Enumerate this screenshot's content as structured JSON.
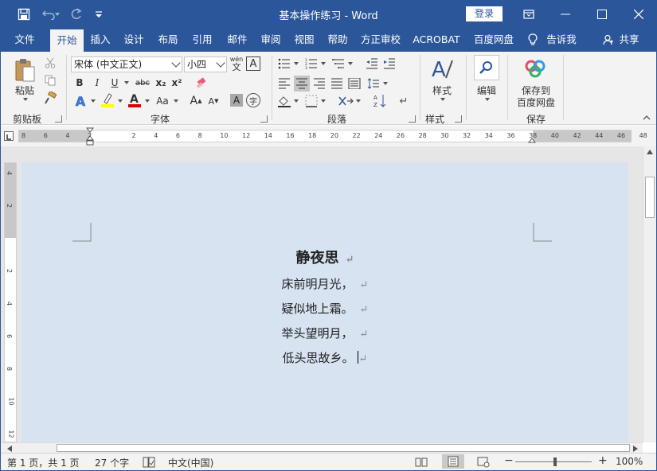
{
  "titlebar": {
    "title": "基本操作练习  -  Word",
    "login": "登录"
  },
  "tabs": [
    "文件",
    "开始",
    "插入",
    "设计",
    "布局",
    "引用",
    "邮件",
    "审阅",
    "视图",
    "帮助",
    "方正审校",
    "ACROBAT",
    "百度网盘"
  ],
  "tell_me": "告诉我",
  "share": "共享",
  "ribbon": {
    "paste": "粘贴",
    "clipboard": "剪贴板",
    "font_name": "宋体 (中文正文)",
    "font_size": "小四",
    "font_group": "字体",
    "paragraph_group": "段落",
    "styles": "样式",
    "styles_group": "样式",
    "edit": "编辑",
    "save_to": "保存到",
    "baidu": "百度网盘",
    "save_group": "保存",
    "bold": "B",
    "italic": "I",
    "underline": "U",
    "strike": "abc",
    "sub": "x₂",
    "sup": "x²",
    "font_a": "A",
    "aa": "Aa",
    "grow": "A",
    "shrink": "A",
    "char_border": "A",
    "phonetic_top": "wén",
    "phonetic_bottom": "文",
    "enclose": "字"
  },
  "ruler": {
    "h_ticks": [
      "8",
      "6",
      "4",
      "2",
      "",
      "2",
      "4",
      "6",
      "8",
      "10",
      "12",
      "14",
      "16",
      "18",
      "20",
      "22",
      "24",
      "26",
      "28",
      "30",
      "32",
      "34",
      "36",
      "38",
      "40",
      "42",
      "44",
      "46",
      "48"
    ],
    "v_ticks": [
      "4",
      "2",
      "",
      "2",
      "4",
      "6",
      "8",
      "10",
      "12"
    ]
  },
  "document": {
    "title": "静夜思",
    "lines": [
      "床前明月光，",
      "疑似地上霜。",
      "举头望明月，",
      "低头思故乡。"
    ],
    "mark": "↵"
  },
  "status": {
    "page": "第 1 页，共 1 页",
    "words": "27 个字",
    "language": "中文(中国)",
    "zoom": "100%",
    "minus": "−",
    "plus": "+"
  }
}
